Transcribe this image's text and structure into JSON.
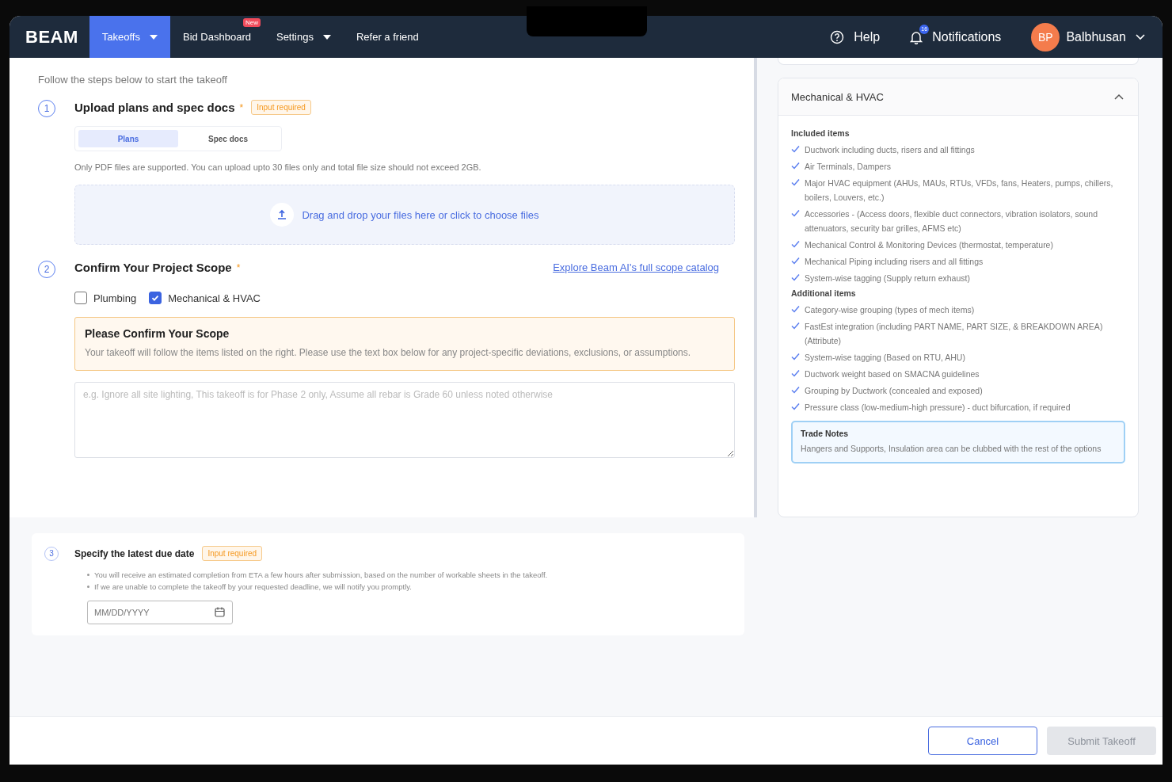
{
  "nav": {
    "logo": "BEAM",
    "items": [
      {
        "label": "Takeoffs",
        "selected": true,
        "dropdown": true
      },
      {
        "label": "Bid Dashboard",
        "selected": false,
        "dropdown": false,
        "badge": "New"
      },
      {
        "label": "Settings",
        "selected": false,
        "dropdown": true
      },
      {
        "label": "Refer a friend",
        "selected": false,
        "dropdown": false
      }
    ],
    "help": "Help",
    "notifications": {
      "label": "Notifications",
      "badge": "16"
    },
    "user": {
      "initials": "BP",
      "name": "Balbhusan"
    }
  },
  "intro": "Follow the steps below to start the takeoff",
  "step1": {
    "number": "1",
    "title": "Upload plans and spec docs",
    "required": "*",
    "tag": "Input required",
    "tabs": [
      {
        "label": "Plans",
        "selected": true
      },
      {
        "label": "Spec docs",
        "selected": false
      }
    ],
    "note": "Only PDF files are supported. You can upload upto 30 files only and total file size should not exceed 2GB.",
    "dropzone": "Drag and drop your files here or click to choose files"
  },
  "step2": {
    "number": "2",
    "title": "Confirm Your Project Scope",
    "required": "*",
    "link": "Explore Beam AI's full scope catalog",
    "checkboxes": [
      {
        "label": "Plumbing",
        "checked": false
      },
      {
        "label": "Mechanical & HVAC",
        "checked": true
      }
    ],
    "callout": {
      "title": "Please Confirm Your Scope",
      "text": "Your takeoff will follow the items listed on the right. Please use the text box below for any project-specific deviations, exclusions, or assumptions."
    },
    "placeholder": "e.g. Ignore all site lighting, This takeoff is for Phase 2 only, Assume all rebar is Grade 60 unless noted otherwise"
  },
  "scope": {
    "title": "Mechanical & HVAC",
    "expanded": true,
    "sections": [
      {
        "heading": "Included items",
        "items": [
          "Ductwork including ducts, risers and all fittings",
          "Air Terminals, Dampers",
          "Major HVAC equipment (AHUs, MAUs, RTUs, VFDs, fans, Heaters, pumps, chillers, boilers, Louvers, etc.)",
          "Accessories - (Access doors, flexible duct connectors, vibration isolators, sound attenuators, security bar grilles, AFMS etc)",
          "Mechanical Control & Monitoring Devices (thermostat, temperature)",
          "Mechanical Piping including risers and all fittings",
          "System-wise tagging (Supply return exhaust)"
        ]
      },
      {
        "heading": "Additional items",
        "items": [
          "Category-wise grouping (types of mech items)",
          "FastEst integration (including PART NAME, PART SIZE, & BREAKDOWN AREA) (Attribute)",
          "System-wise tagging (Based on RTU, AHU)",
          "Ductwork weight based on SMACNA guidelines",
          "Grouping by Ductwork (concealed and exposed)",
          "Pressure class (low-medium-high pressure) - duct bifurcation, if required"
        ]
      }
    ],
    "trade_notes": {
      "title": "Trade Notes",
      "text": "Hangers and Supports, Insulation area can be clubbed with the rest of the options"
    }
  },
  "step3": {
    "number": "3",
    "title": "Specify the latest due date",
    "tag": "Input required",
    "bullets": [
      "You will receive an estimated completion from ETA a few hours after submission, based on the number of workable sheets in the takeoff.",
      "If we are unable to complete the takeoff by your requested deadline, we will notify you promptly."
    ],
    "placeholder": "MM/DD/YYYY"
  },
  "footer": {
    "buttons": [
      {
        "label": "Cancel",
        "kind": "secondary",
        "disabled": false
      },
      {
        "label": "Submit Takeoff",
        "kind": "primary",
        "disabled": true
      }
    ]
  }
}
